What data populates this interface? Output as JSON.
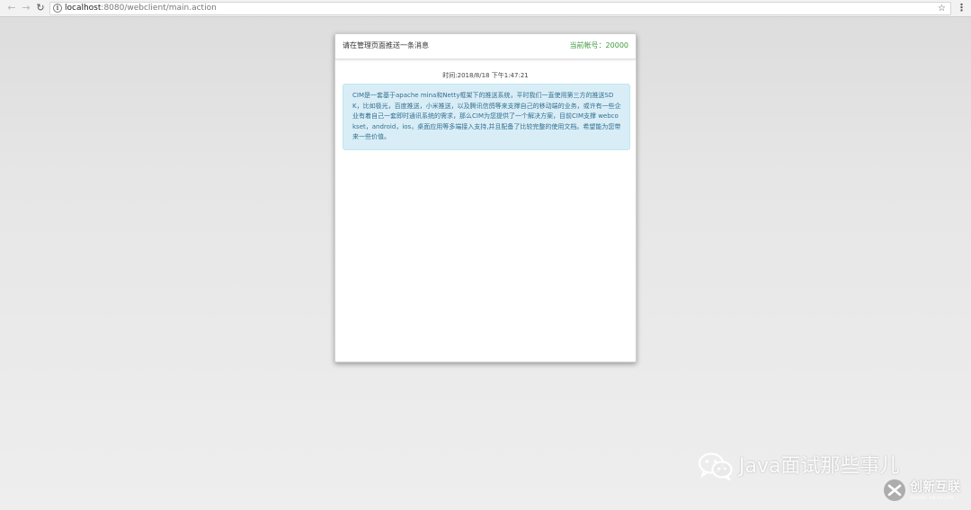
{
  "browser": {
    "url_host": "localhost",
    "url_rest": ":8080/webclient/main.action",
    "icons": {
      "back": "arrow-left",
      "forward": "arrow-right",
      "reload": "reload",
      "info": "info-circle",
      "bookmark": "star",
      "menu": "vertical-dots"
    }
  },
  "panel": {
    "title": "请在管理页面推送一条消息",
    "account": "当前帐号：20000",
    "message": {
      "time": "时间:2018/8/18 下午1:47:21",
      "text": "CIM是一套基于apache mina和Netty框架下的推送系统，平时我们一直使用第三方的推送SDK，比如极光，百度推送，小米推送，以及腾讯信鸽等来支撑自己的移动端的业务，或许有一些企业有着自己一套即时通讯系统的需求，那么CIM为您提供了一个解决方案，目前CIM支撑 webcokset，android，ios，桌面应用等多端接入支持,并且配备了比较完整的使用文档。希望能为您带来一些价值。"
    }
  },
  "colors": {
    "account_green": "#3c9a3c",
    "bubble_bg": "#d9edf7",
    "bubble_text": "#31708f"
  },
  "watermarks": {
    "wechat_text": "Java面试那些事儿",
    "brand_name": "创新互联",
    "brand_sub": "CHUANG XIN HU LIAN"
  }
}
